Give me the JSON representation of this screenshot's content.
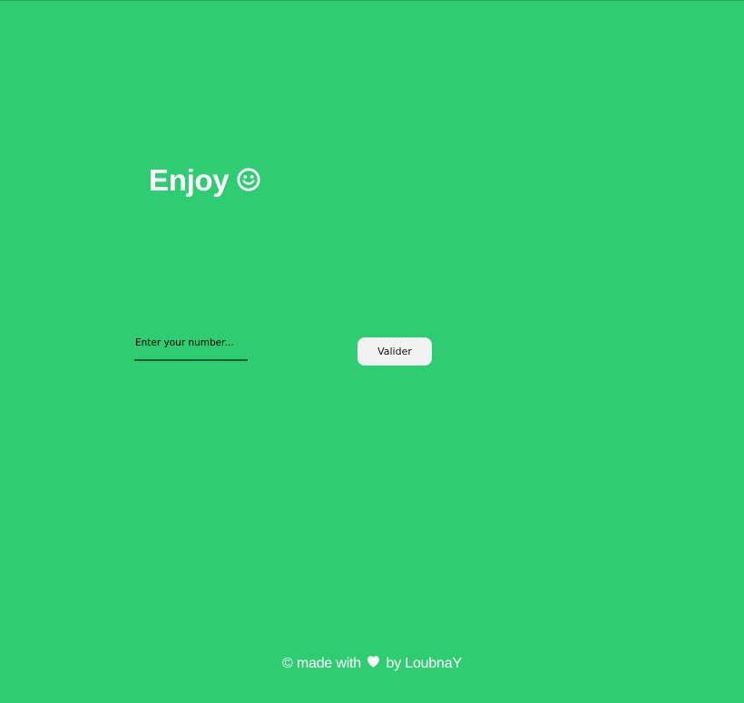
{
  "header": {
    "title": "Enjoy",
    "title_icon": "smiley-icon"
  },
  "form": {
    "number_input": {
      "value": "",
      "placeholder": "Enter your number..."
    },
    "submit_label": "Valider"
  },
  "footer": {
    "prefix": "© made with",
    "icon": "heart-icon",
    "suffix": "by LoubnaY"
  },
  "colors": {
    "background": "#2ecd71",
    "text": "#ffffff",
    "button_background": "#f2f2f2"
  }
}
